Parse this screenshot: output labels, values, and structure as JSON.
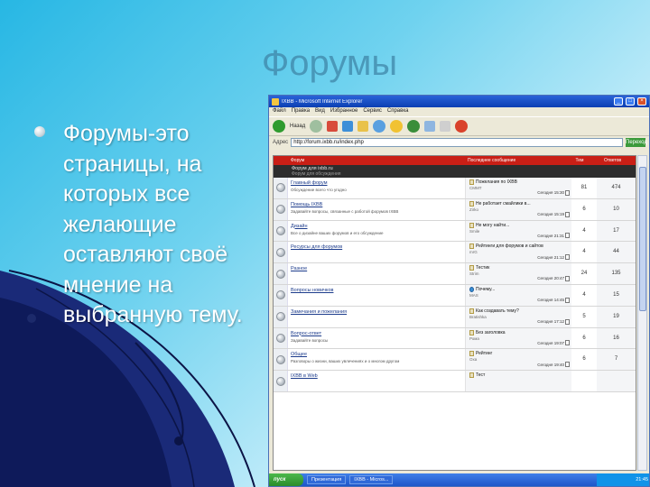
{
  "slide": {
    "title": "Форумы",
    "bullets": [
      "Форумы-это страницы, на которых все желающие оставляют своё мнение на выбранную тему."
    ]
  },
  "browser": {
    "window_title": "IXBB - Microsoft Internet Explorer",
    "menu": [
      "Файл",
      "Правка",
      "Вид",
      "Избранное",
      "Сервис",
      "Справка"
    ],
    "toolbar": {
      "back_label": "Назад"
    },
    "address_label": "Адрес",
    "address_value": "http://forum.ixbb.ru/index.php",
    "go_label": "Переход"
  },
  "forum": {
    "header": {
      "forum": "Форум",
      "last_post": "Последнее сообщение",
      "topics": "Тем",
      "posts": "Ответов"
    },
    "category": {
      "title": "Форум для ixbb.ru",
      "subtitle": "Форум для обсуждения"
    },
    "rows": [
      {
        "title": "Главный форум",
        "desc": "Обсуждение всего что угодно",
        "last_title": "Пожелания по IXBB",
        "last_user": "CMMT",
        "last_date": "Сегодня 15:30",
        "topics": "81",
        "posts": "474",
        "icon_type": "post"
      },
      {
        "title": "Помощь IXBB",
        "desc": "Задавайте вопросы, связанные с работой форумов IXBB",
        "last_title": "Не работает cмайлики в...",
        "last_user": "Zirko",
        "last_date": "Сегодня 15:19",
        "topics": "6",
        "posts": "10",
        "icon_type": "post"
      },
      {
        "title": "Дизайн",
        "desc": "Все о дизайне ваших форумов и его обсуждение",
        "last_title": "Не могу найти...",
        "last_user": "Smile",
        "last_date": "Сегодня 21:31",
        "topics": "4",
        "posts": "17",
        "icon_type": "post"
      },
      {
        "title": "Ресурсы для форумов",
        "desc": "",
        "last_title": "Рейтинги для форумов и сайтов",
        "last_user": "mrG",
        "last_date": "Сегодня 21:12",
        "topics": "4",
        "posts": "44",
        "icon_type": "post"
      },
      {
        "title": "Разное",
        "desc": "",
        "last_title": "Тестик",
        "last_user": "Strim",
        "last_date": "Сегодня 20:47",
        "topics": "24",
        "posts": "135",
        "icon_type": "post"
      },
      {
        "title": "Вопросы новичков",
        "desc": "",
        "last_title": "Почему...",
        "last_user": "MAS",
        "last_date": "Сегодня 14:45",
        "topics": "4",
        "posts": "15",
        "icon_type": "globe"
      },
      {
        "title": "Замечания и пожелания",
        "desc": "",
        "last_title": "Как создавать тему?",
        "last_user": "Bratishka",
        "last_date": "Сегодня 17:12",
        "topics": "5",
        "posts": "19",
        "icon_type": "post"
      },
      {
        "title": "Вопрос-ответ",
        "desc": "Задавайте вопросы",
        "last_title": "Без заголовка",
        "last_user": "Рома",
        "last_date": "Сегодня 19:07",
        "topics": "6",
        "posts": "16",
        "icon_type": "post"
      },
      {
        "title": "Общее",
        "desc": "Разговоры о жизни, ваших увлечениях и о многом другом",
        "last_title": "Рейтинг",
        "last_user": "Oxa",
        "last_date": "Сегодня 19:40",
        "topics": "6",
        "posts": "7",
        "icon_type": "post"
      },
      {
        "title": "IXBB в Web",
        "desc": "",
        "last_title": "Тест",
        "last_user": "",
        "last_date": "",
        "topics": "",
        "posts": "",
        "icon_type": "post"
      }
    ]
  },
  "taskbar": {
    "start": "пуск",
    "items": [
      "Презентация",
      "IXBB - Micros..."
    ],
    "clock": "21:45"
  },
  "colors": {
    "forum_header": "#c91f16",
    "category_bar": "#2d2d2d",
    "link": "#1d3c8c",
    "slide_title": "#3f86a8"
  }
}
